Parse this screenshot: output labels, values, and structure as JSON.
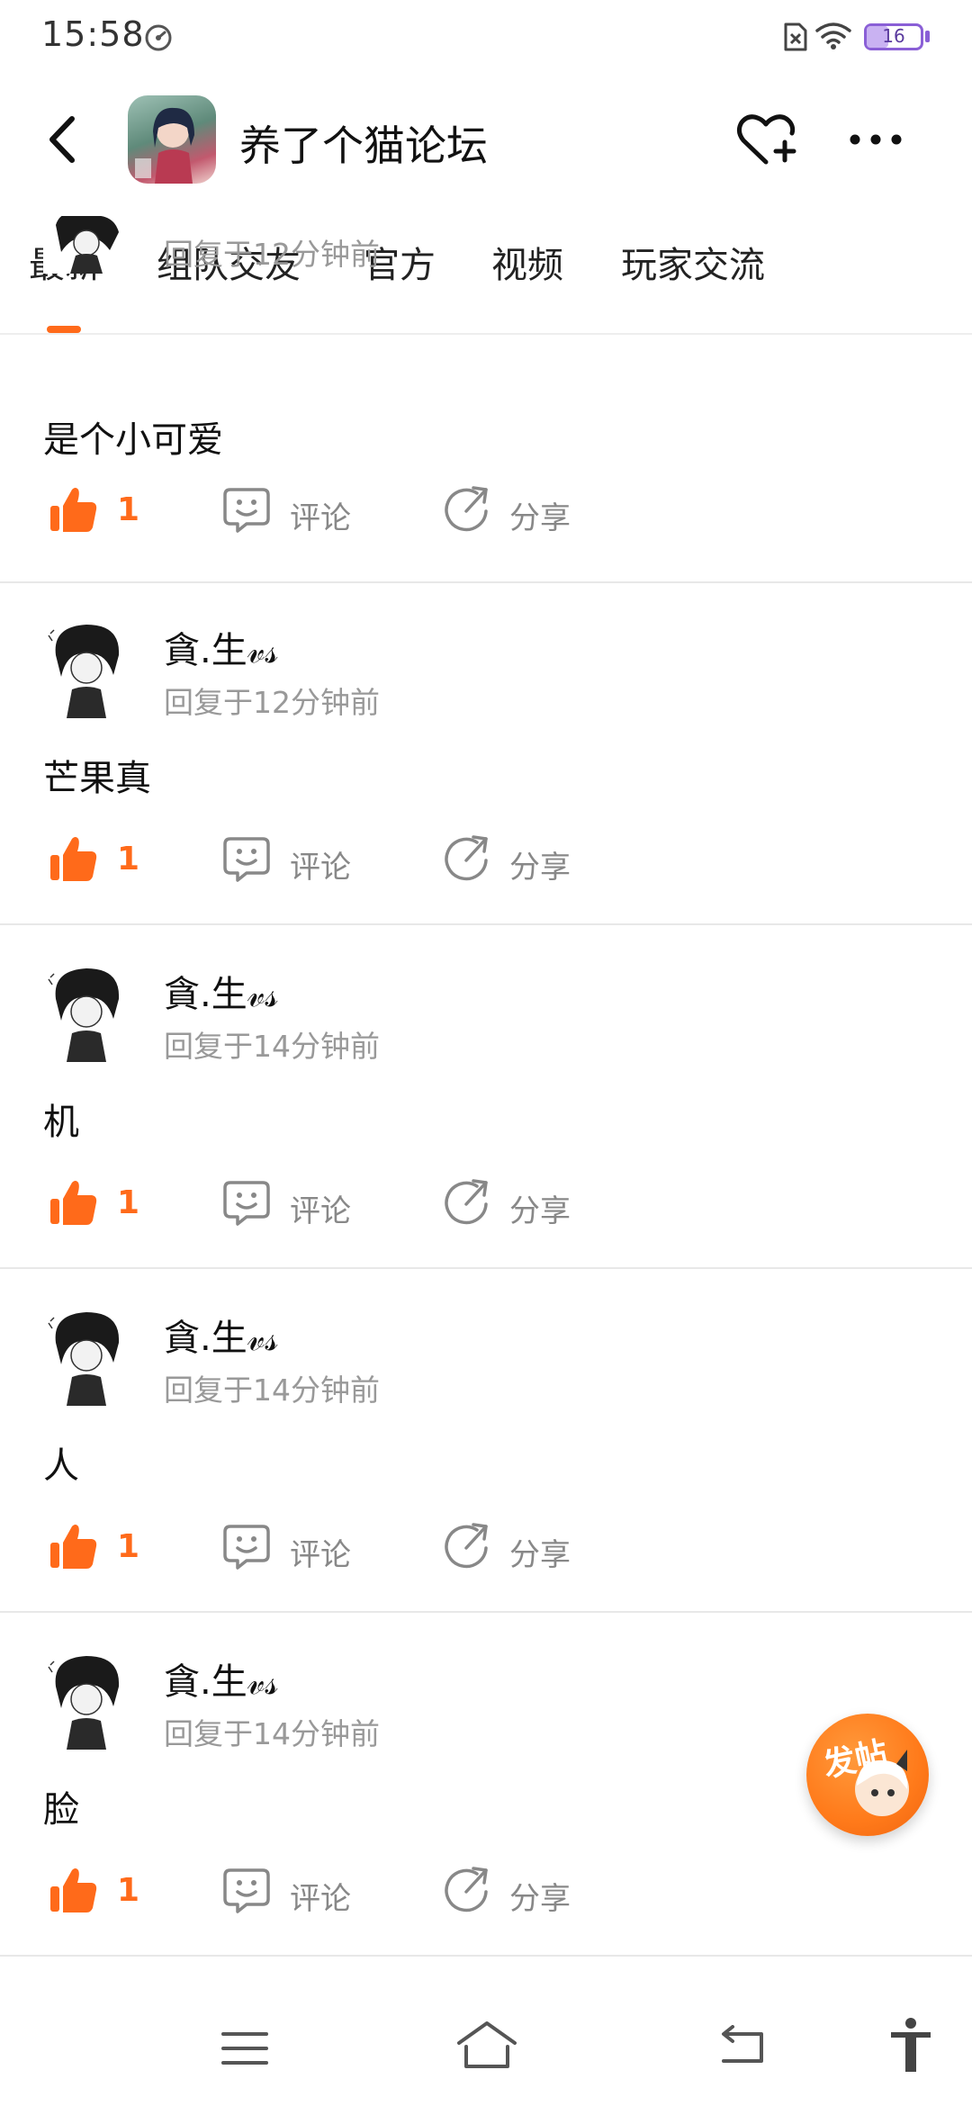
{
  "status_bar": {
    "time": "15:58",
    "battery_level": "16",
    "icons": [
      "speedometer-icon",
      "sim-error-icon",
      "wifi-icon",
      "battery-icon"
    ]
  },
  "header": {
    "forum_title": "养了个猫论坛",
    "icons": [
      "back-icon",
      "forum-avatar",
      "heart-plus-icon",
      "more-icon"
    ]
  },
  "tabs": [
    {
      "label": "最新",
      "active": true
    },
    {
      "label": "组队交友",
      "active": false
    },
    {
      "label": "官方",
      "active": false
    },
    {
      "label": "视频",
      "active": false
    },
    {
      "label": "玩家交流",
      "active": false
    }
  ],
  "colors": {
    "accent": "#ff6a1a",
    "secondary_text": "#999999",
    "battery": "#8a5fd6"
  },
  "posts": [
    {
      "username": "",
      "time": "回复于12分钟前",
      "content": "是个小可爱",
      "likes": "1",
      "comment_label": "评论",
      "share_label": "分享"
    },
    {
      "username": "貪.生𝓋𝓈",
      "time": "回复于12分钟前",
      "content": "芒果真",
      "likes": "1",
      "comment_label": "评论",
      "share_label": "分享"
    },
    {
      "username": "貪.生𝓋𝓈",
      "time": "回复于14分钟前",
      "content": "机",
      "likes": "1",
      "comment_label": "评论",
      "share_label": "分享"
    },
    {
      "username": "貪.生𝓋𝓈",
      "time": "回复于14分钟前",
      "content": "人",
      "likes": "1",
      "comment_label": "评论",
      "share_label": "分享"
    },
    {
      "username": "貪.生𝓋𝓈",
      "time": "回复于14分钟前",
      "content": "脸",
      "likes": "1",
      "comment_label": "评论",
      "share_label": "分享"
    }
  ],
  "fab": {
    "label": "发帖"
  },
  "bottom_nav": {
    "icons": [
      "menu-icon",
      "home-icon",
      "back-nav-icon",
      "accessibility-icon"
    ]
  }
}
